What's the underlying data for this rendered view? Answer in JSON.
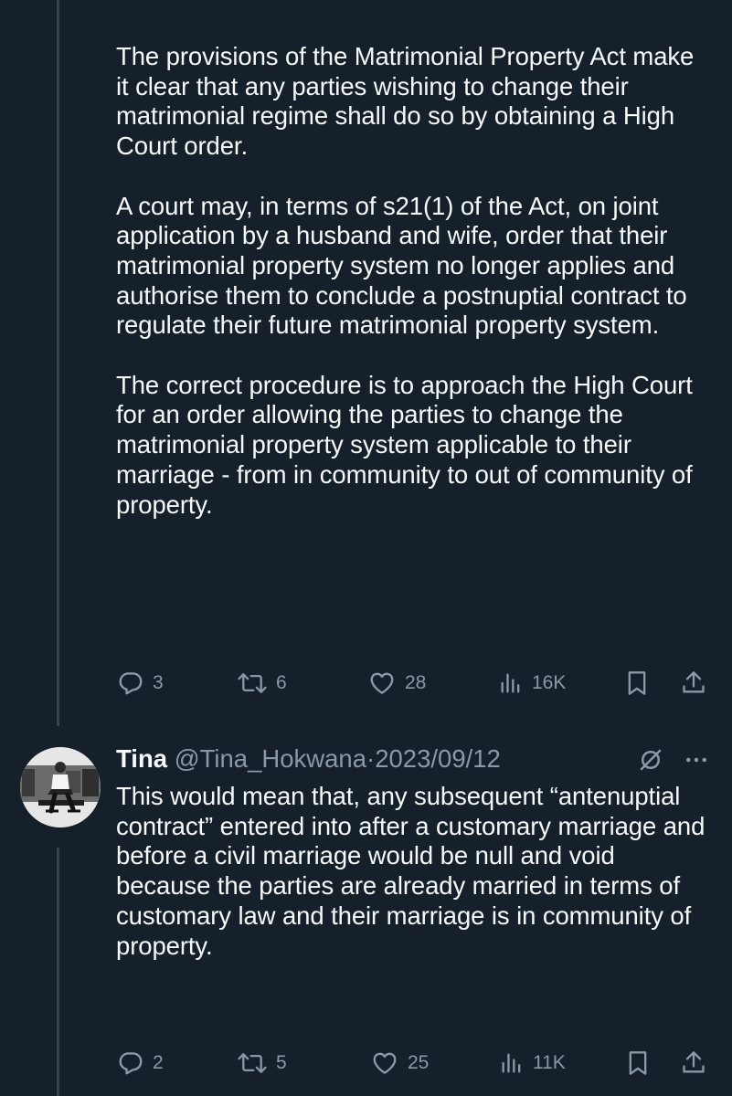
{
  "thread": {
    "tweet1": {
      "paragraphs": [
        "The provisions of the Matrimonial Property Act make it clear that any parties wishing to change their matrimonial regime shall do so by obtaining a High Court order.",
        "A court may, in terms of s21(1) of the Act, on joint application by a husband and wife, order that their matrimonial property system no longer applies and authorise them to conclude a postnuptial contract to regulate their future matrimonial property system.",
        "The correct procedure is to approach the High Court for an order allowing the parties to change the matrimonial property system applicable to their marriage - from in community to out of community of property."
      ],
      "replies": "3",
      "retweets": "6",
      "likes": "28",
      "views": "16K"
    },
    "tweet2": {
      "author_name": "Tina",
      "author_handle": "@Tina_Hokwana",
      "separator": "·",
      "date": "2023/09/12",
      "text": "This would mean that, any subsequent “antenuptial contract” entered into after a customary marriage and before a civil marriage would be null and void because the parties are already married in terms of customary law and their marriage is in community of property.",
      "replies": "2",
      "retweets": "5",
      "likes": "25",
      "views": "11K"
    }
  },
  "icons": {
    "reply": "speech-bubble-icon",
    "retweet": "retweet-arrows-icon",
    "like": "heart-icon",
    "views": "bar-chart-icon",
    "bookmark": "bookmark-icon",
    "share": "share-upload-icon",
    "grok": "slashed-circle-icon",
    "more": "ellipsis-icon"
  },
  "colors": {
    "background": "#15202b",
    "text": "#f7f9f9",
    "muted": "#8b98a5",
    "thread_line": "#38444d"
  }
}
